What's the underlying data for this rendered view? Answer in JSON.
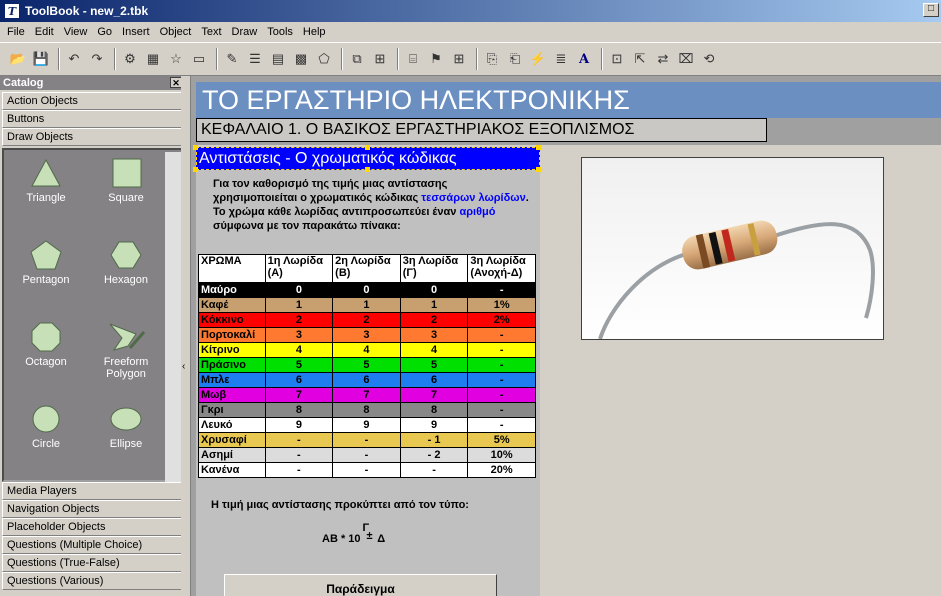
{
  "window": {
    "title": "ToolBook - new_2.tbk"
  },
  "menu": [
    "File",
    "Edit",
    "View",
    "Go",
    "Insert",
    "Object",
    "Text",
    "Draw",
    "Tools",
    "Help"
  ],
  "catalog": {
    "title": "Catalog",
    "top_categories": [
      "Action Objects",
      "Buttons",
      "Draw Objects"
    ],
    "shapes": [
      "Triangle",
      "Square",
      "Pentagon",
      "Hexagon",
      "Octagon",
      "Freeform Polygon",
      "Circle",
      "Ellipse"
    ],
    "bottom_categories": [
      "Media Players",
      "Navigation Objects",
      "Placeholder Objects",
      "Questions (Multiple Choice)",
      "Questions (True-False)",
      "Questions (Various)"
    ],
    "shape_fill": "#c8e0b8"
  },
  "page": {
    "banner": "ΤΟ ΕΡΓΑΣΤΗΡΙΟ ΗΛΕΚΤΡΟΝΙΚΗΣ",
    "subtitle": "ΚΕΦΑΛΑΙΟ 1. Ο ΒΑΣΙΚΟΣ ΕΡΓΑΣΤΗΡΙΑΚΟΣ ΕΞΟΠΛΙΣΜΟΣ",
    "section_title": "Αντιστάσεις - Ο χρωματικός κώδικας",
    "intro": {
      "p1a": "Για τον καθορισμό της τιμής μιας αντίστασης χρησιμοποιείται ο χρωματικός κώδικας ",
      "p1b": "τεσσάρων λωρίδων",
      "p1c": ".",
      "p2a": "Το χρώμα κάθε λωρίδας αντιπροσωπεύει έναν ",
      "p2b": "αριθμό",
      "p2c": " σύμφωνα με τον παρακάτω πίνακα:"
    },
    "table": {
      "headers": [
        "ΧΡΩΜΑ",
        "1η Λωρίδα (Α)",
        "2η Λωρίδα (Β)",
        "3η Λωρίδα (Γ)",
        "3η Λωρίδα (Ανοχή-Δ)"
      ],
      "rows": [
        {
          "cells": [
            "Μαύρο",
            "0",
            "0",
            "0",
            "-"
          ],
          "bg": "#000000",
          "fg": "#ffffff"
        },
        {
          "cells": [
            "Καφέ",
            "1",
            "1",
            "1",
            "1%"
          ],
          "bg": "#c8a070",
          "fg": "#000000"
        },
        {
          "cells": [
            "Κόκκινο",
            "2",
            "2",
            "2",
            "2%"
          ],
          "bg": "#ff0000",
          "fg": "#000000"
        },
        {
          "cells": [
            "Πορτοκαλί",
            "3",
            "3",
            "3",
            "-"
          ],
          "bg": "#ff7a30",
          "fg": "#000000"
        },
        {
          "cells": [
            "Κίτρινο",
            "4",
            "4",
            "4",
            "-"
          ],
          "bg": "#ffff00",
          "fg": "#000000"
        },
        {
          "cells": [
            "Πράσινο",
            "5",
            "5",
            "5",
            "-"
          ],
          "bg": "#00e000",
          "fg": "#000000"
        },
        {
          "cells": [
            "Μπλε",
            "6",
            "6",
            "6",
            "-"
          ],
          "bg": "#1e7ef0",
          "fg": "#000000"
        },
        {
          "cells": [
            "Μωβ",
            "7",
            "7",
            "7",
            "-"
          ],
          "bg": "#e000e0",
          "fg": "#000000"
        },
        {
          "cells": [
            "Γκρι",
            "8",
            "8",
            "8",
            "-"
          ],
          "bg": "#888888",
          "fg": "#000000"
        },
        {
          "cells": [
            "Λευκό",
            "9",
            "9",
            "9",
            "-"
          ],
          "bg": "#ffffff",
          "fg": "#000000"
        },
        {
          "cells": [
            "Χρυσαφί",
            "-",
            "-",
            "- 1",
            "5%"
          ],
          "bg": "#e8c850",
          "fg": "#000000"
        },
        {
          "cells": [
            "Ασημί",
            "-",
            "-",
            "- 2",
            "10%"
          ],
          "bg": "#dcdcdc",
          "fg": "#000000"
        },
        {
          "cells": [
            "Κανένα",
            "-",
            "-",
            "-",
            "20%"
          ],
          "bg": "#ffffff",
          "fg": "#000000"
        }
      ]
    },
    "formula_label": "Η τιμή μιας αντίστασης προκύπτει από τον τύπο:",
    "formula": {
      "base": "ΑΒ * 10",
      "exp": "Γ",
      "pm": "±",
      "tol": "Δ"
    },
    "example_button": "Παράδειγμα"
  },
  "colors": {
    "banner": "#6b8fc0",
    "section_title": "#0000ff",
    "link_text": "#0000ff"
  }
}
